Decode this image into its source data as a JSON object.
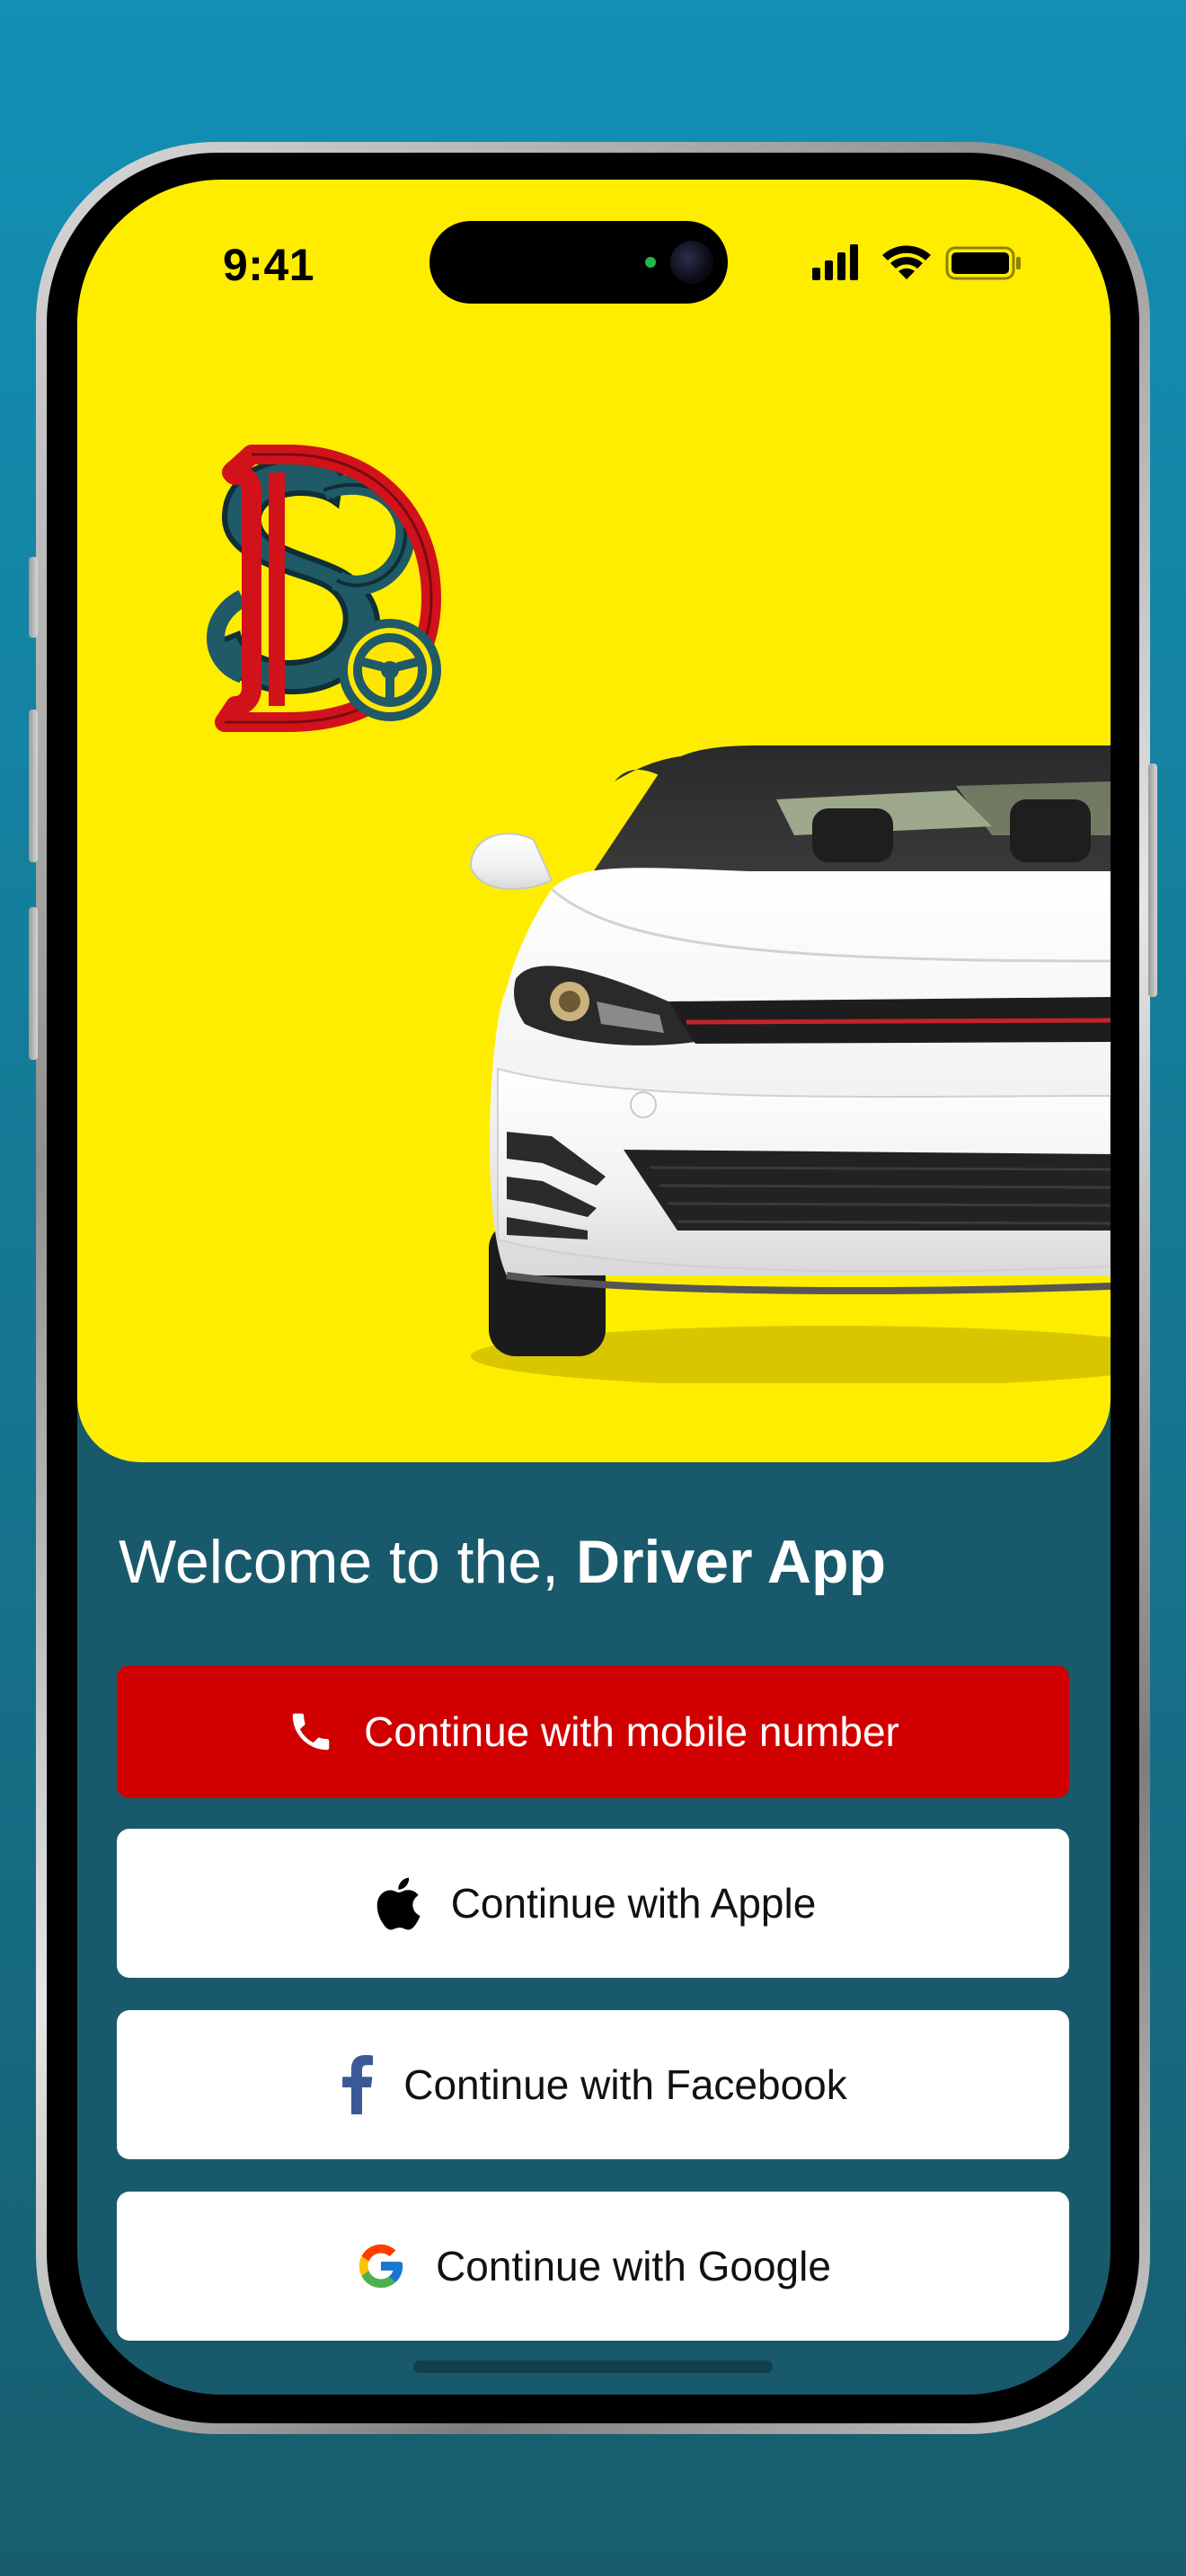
{
  "status_bar": {
    "time": "9:41"
  },
  "hero": {
    "background_color": "#ffed00",
    "logo_icon": "monogram-steering-wheel-logo",
    "car_image": "white-hatchback-front-view"
  },
  "welcome": {
    "prefix": "Welcome to the, ",
    "app_name": "Driver App"
  },
  "buttons": {
    "mobile": {
      "label": "Continue with mobile number",
      "icon": "phone-icon",
      "color": "#d10000"
    },
    "apple": {
      "label": "Continue with Apple",
      "icon": "apple-icon"
    },
    "facebook": {
      "label": "Continue with Facebook",
      "icon": "facebook-icon",
      "icon_color": "#3b5998"
    },
    "google": {
      "label": "Continue with Google",
      "icon": "google-icon"
    }
  },
  "colors": {
    "screen_background": "#185a6b",
    "page_gradient_top": "#1290b5",
    "page_gradient_bottom": "#175d6e"
  }
}
